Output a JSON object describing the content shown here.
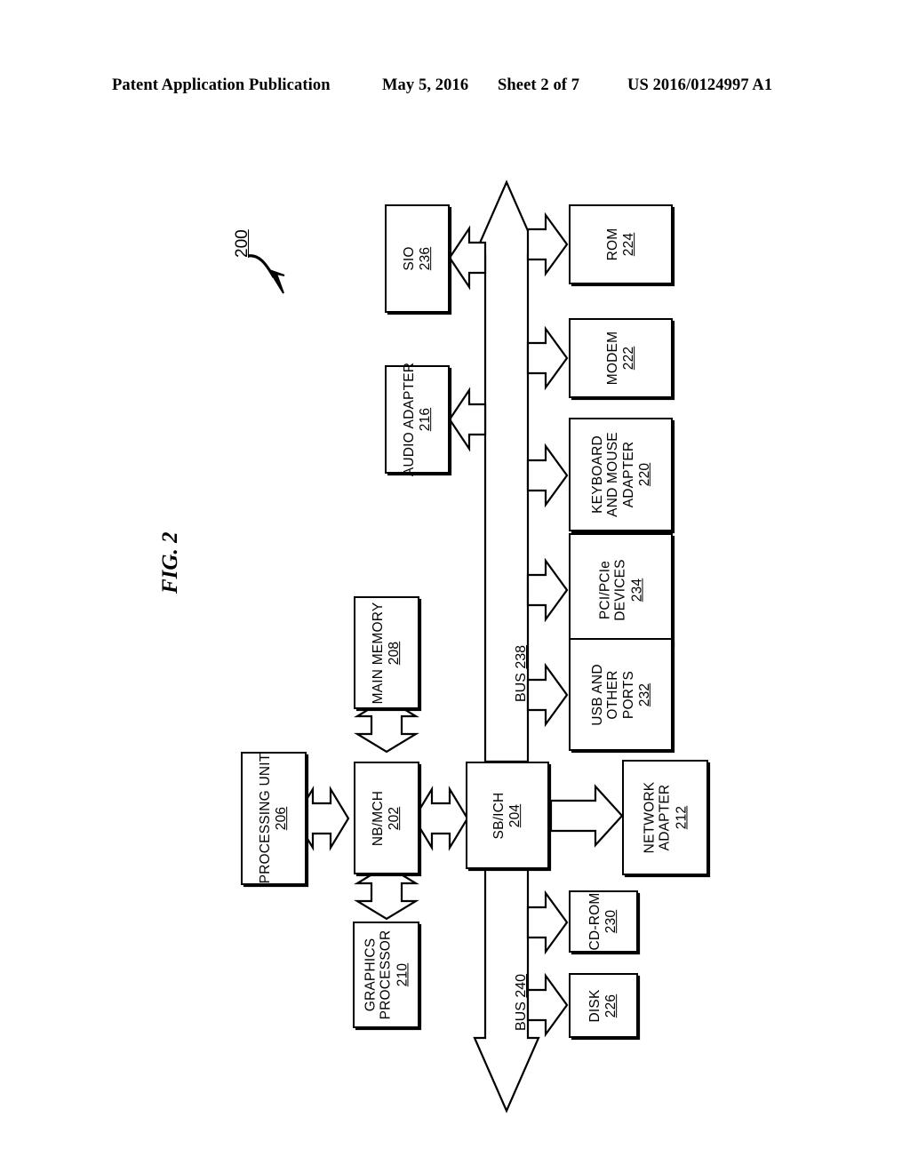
{
  "header": {
    "publication": "Patent Application Publication",
    "date": "May 5, 2016",
    "sheet": "Sheet 2 of 7",
    "patent_number": "US 2016/0124997 A1"
  },
  "figure": {
    "label": "FIG. 2",
    "system_ref": "200"
  },
  "blocks": {
    "sio": {
      "title": "SIO",
      "num": "236"
    },
    "rom": {
      "title": "ROM",
      "num": "224"
    },
    "audio_adapter": {
      "title": "AUDIO ADAPTER",
      "num": "216"
    },
    "modem": {
      "title": "MODEM",
      "num": "222"
    },
    "keyboard_mouse": {
      "title": "KEYBOARD\nAND MOUSE\nADAPTER",
      "num": "220"
    },
    "pci_pcie": {
      "title": "PCI/PCIe\nDEVICES",
      "num": "234"
    },
    "usb_ports": {
      "title": "USB AND\nOTHER\nPORTS",
      "num": "232"
    },
    "main_memory": {
      "title": "MAIN MEMORY",
      "num": "208"
    },
    "processing_unit": {
      "title": "PROCESSING UNIT",
      "num": "206"
    },
    "nb_mch": {
      "title": "NB/MCH",
      "num": "202"
    },
    "sb_ich": {
      "title": "SB/ICH",
      "num": "204"
    },
    "network_adapter": {
      "title": "NETWORK\nADAPTER",
      "num": "212"
    },
    "graphics_processor": {
      "title": "GRAPHICS\nPROCESSOR",
      "num": "210"
    },
    "cd_rom": {
      "title": "CD-ROM",
      "num": "230"
    },
    "disk": {
      "title": "DISK",
      "num": "226"
    }
  },
  "buses": {
    "bus_238": {
      "name": "BUS",
      "num": "238"
    },
    "bus_240": {
      "name": "BUS",
      "num": "240"
    }
  },
  "colors": {
    "ink": "#000000",
    "paper": "#ffffff"
  }
}
